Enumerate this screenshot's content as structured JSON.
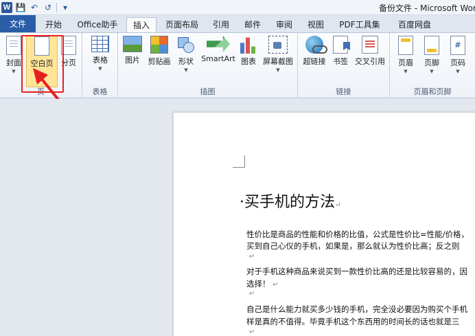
{
  "window": {
    "title": "备份文件 - Microsoft Word",
    "app_icon": "W",
    "qa_save": "💾",
    "qa_undo": "↶",
    "qa_redo": "↺",
    "qa_more": "▾"
  },
  "tabs": [
    "文件",
    "开始",
    "Office助手",
    "插入",
    "页面布局",
    "引用",
    "邮件",
    "审阅",
    "视图",
    "PDF工具集",
    "百度网盘"
  ],
  "ribbon": {
    "groups": {
      "pages": "页",
      "tables": "表格",
      "illustrations": "插图",
      "links": "链接",
      "header_footer": "页眉和页脚"
    },
    "buttons": {
      "cover": "封面",
      "blank_page": "空白页",
      "page_break": "分页",
      "table": "表格",
      "picture": "图片",
      "clipart": "剪贴画",
      "shapes": "形状",
      "smartart": "SmartArt",
      "chart": "图表",
      "screenshot": "屏幕截图",
      "hyperlink": "超链接",
      "bookmark": "书签",
      "cross_ref": "交叉引用",
      "header": "页眉",
      "footer": "页脚",
      "page_number": "页码"
    },
    "page_number_glyph": "#"
  },
  "document": {
    "title": "买手机的方法",
    "paragraphs": [
      "性价比是商品的性能和价格的比值，公式是性价比=性能/价格，",
      "买到自己心仪的手机，如果是，那么就认为性价比高；反之则",
      "对于手机这种商品来说买到一款性价比高的还是比较容易的，因",
      "选择！",
      "自己是什么能力就买多少钱的手机，完全没必要因为购买个手机",
      "样是真的不值得。毕竟手机这个东西用的时间长的话也就是三"
    ],
    "para_mark": "↵",
    "bullet": "·"
  }
}
